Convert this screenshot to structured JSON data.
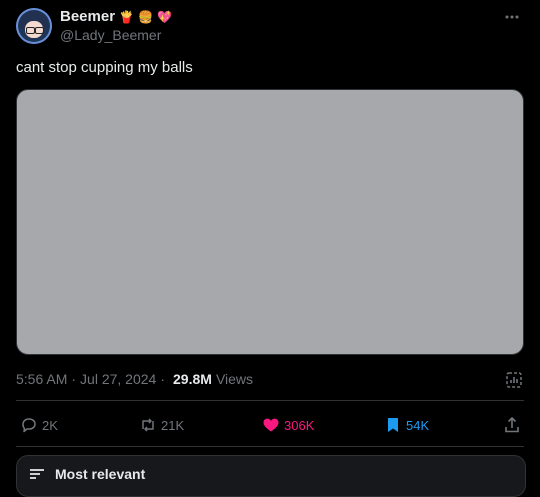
{
  "author": {
    "display_name": "Beemer",
    "badges": [
      "🍟",
      "🍔",
      "💖"
    ],
    "handle": "@Lady_Beemer"
  },
  "tweet": {
    "text": "cant stop cupping my balls"
  },
  "meta": {
    "time": "5:56 AM",
    "separator": "·",
    "date": "Jul 27, 2024",
    "views_count": "29.8M",
    "views_label": "Views"
  },
  "actions": {
    "replies": "2K",
    "reposts": "21K",
    "likes": "306K",
    "bookmarks": "54K"
  },
  "replies_sort": {
    "label": "Most relevant"
  },
  "colors": {
    "background": "#000000",
    "text_primary": "#e7e9ea",
    "text_secondary": "#71767b",
    "like_pink": "#f91880",
    "bookmark_blue": "#1d9bf0",
    "divider": "#2f3336"
  }
}
